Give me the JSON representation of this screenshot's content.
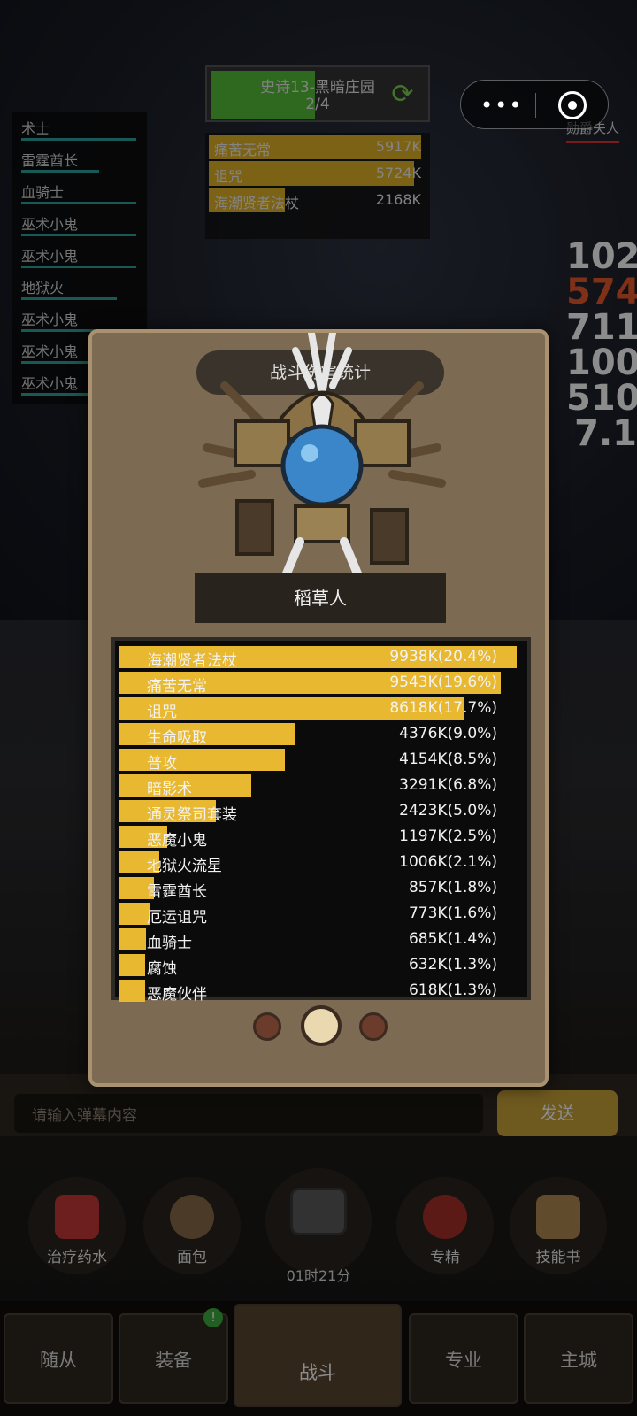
{
  "stage": {
    "title": "史诗13-黑暗庄园",
    "progress": "2/4"
  },
  "enemy": {
    "name": "勋爵夫人"
  },
  "party": [
    "术士",
    "雷霆酋长",
    "血骑士",
    "巫术小鬼",
    "巫术小鬼",
    "地狱火",
    "巫术小鬼",
    "巫术小鬼",
    "巫术小鬼"
  ],
  "mini_damage": [
    {
      "name": "痛苦无常",
      "value": "5917K"
    },
    {
      "name": "诅咒",
      "value": "5724K"
    },
    {
      "name": "海潮贤者法杖",
      "value": "2168K"
    }
  ],
  "floating_numbers": [
    "102",
    "574",
    "711",
    "100",
    "510",
    "7.1"
  ],
  "modal": {
    "header": "战斗伤害统计",
    "boss_name": "稻草人",
    "damage_rows": [
      {
        "name": "海潮贤者法杖",
        "value": "9938K(20.4%)",
        "pct": 20.4
      },
      {
        "name": "痛苦无常",
        "value": "9543K(19.6%)",
        "pct": 19.6
      },
      {
        "name": "诅咒",
        "value": "8618K(17.7%)",
        "pct": 17.7
      },
      {
        "name": "生命吸取",
        "value": "4376K(9.0%)",
        "pct": 9.0
      },
      {
        "name": "普攻",
        "value": "4154K(8.5%)",
        "pct": 8.5
      },
      {
        "name": "暗影术",
        "value": "3291K(6.8%)",
        "pct": 6.8
      },
      {
        "name": "通灵祭司套装",
        "value": "2423K(5.0%)",
        "pct": 5.0
      },
      {
        "name": "恶魔小鬼",
        "value": "1197K(2.5%)",
        "pct": 2.5
      },
      {
        "name": "地狱火流星",
        "value": "1006K(2.1%)",
        "pct": 2.1
      },
      {
        "name": "雷霆酋长",
        "value": "857K(1.8%)",
        "pct": 1.8
      },
      {
        "name": "厄运诅咒",
        "value": "773K(1.6%)",
        "pct": 1.6
      },
      {
        "name": "血骑士",
        "value": "685K(1.4%)",
        "pct": 1.4
      },
      {
        "name": "腐蚀",
        "value": "632K(1.3%)",
        "pct": 1.3
      },
      {
        "name": "恶魔伙伴",
        "value": "618K(1.3%)",
        "pct": 1.3
      }
    ],
    "pager": {
      "count": 3,
      "active": 1
    }
  },
  "chat": {
    "placeholder": "请输入弹幕内容",
    "send_label": "发送"
  },
  "items": [
    {
      "label": "治疗药水",
      "icon": "potion-icon"
    },
    {
      "label": "面包",
      "icon": "bread-icon"
    },
    {
      "label": "",
      "icon": "chest-icon"
    },
    {
      "label": "专精",
      "icon": "specialization-icon"
    },
    {
      "label": "技能书",
      "icon": "skill-book-icon"
    }
  ],
  "chest_timer": "01时21分",
  "nav": {
    "tabs": [
      "随从",
      "装备",
      "战斗",
      "专业",
      "主城"
    ],
    "active": "战斗",
    "equip_badge": "!"
  },
  "colors": {
    "damage_bar": "#e8b830",
    "panel": "#7c6a52",
    "hp_bar": "#2fa39b"
  }
}
